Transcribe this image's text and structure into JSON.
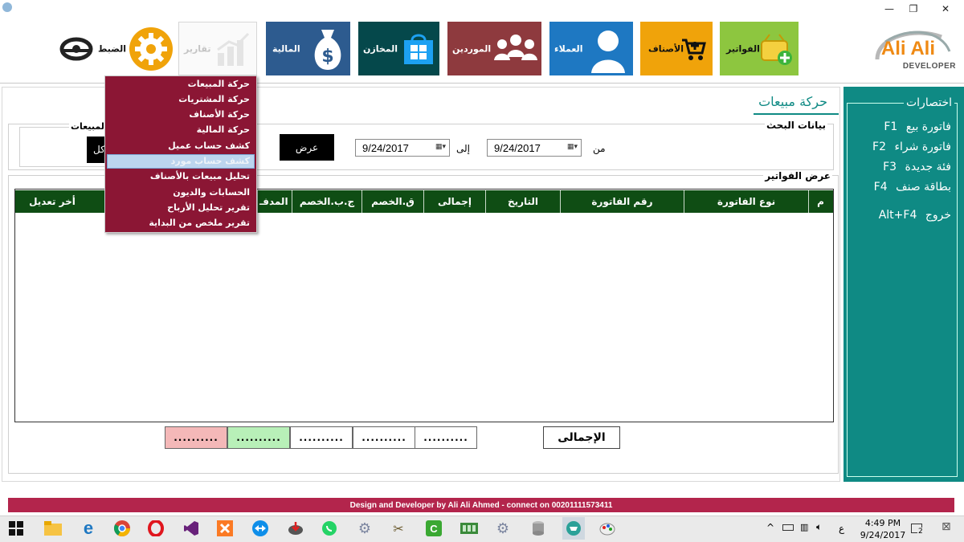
{
  "window": {
    "minimize_glyph": "—",
    "restore_glyph": "❐",
    "close_glyph": "✕"
  },
  "logo": {
    "name": "Ali Ali",
    "sub": "DEVELOPER"
  },
  "tiles": {
    "invoices": "الفواتير",
    "items": "الأصناف",
    "customers": "العملاء",
    "suppliers": "الموردين",
    "stores": "المخازن",
    "finance": "المالية",
    "reports": "تقارير",
    "settings": "الضبط"
  },
  "reports_menu": [
    "حركة المبيعات",
    "حركة المشتريات",
    "حركة الأصناف",
    "حركة المالية",
    "كشف حساب عميل",
    "كشف حساب مورد",
    "تحليل مبيعات بالأصناف",
    "الحسابات والديون",
    "تقرير تحليل الأرباح",
    "تقرير ملخص من البداية"
  ],
  "page": {
    "title": "حركة مبيعات",
    "search_section": "بيانات البحث",
    "sales_group_partial": "المبيعات",
    "all_button_partial": "كل",
    "from_label": "من",
    "to_label": "إلى",
    "from_date": "9/24/2017",
    "to_date": "9/24/2017",
    "show_button": "عرض",
    "invoices_section": "عرض الفواتير"
  },
  "table": {
    "columns": [
      "م",
      "نوع الفاتورة",
      "رقم الفاتورة",
      "التاريخ",
      "إجمالى",
      "ق.الخصم",
      "ج.ب.الخصم",
      "المدفـ",
      "أخر تعديل"
    ]
  },
  "totals": {
    "label": "الإجمالى",
    "boxes": [
      "..........",
      "..........",
      "..........",
      "..........",
      ".........."
    ]
  },
  "shortcuts": {
    "title": "اختصارات",
    "items": [
      {
        "label": "فاتورة بيع",
        "key": "F1"
      },
      {
        "label": "فاتورة شراء",
        "key": "F2"
      },
      {
        "label": "فئة جديدة",
        "key": "F3"
      },
      {
        "label": "بطاقة صنف",
        "key": "F4"
      }
    ],
    "exit": {
      "label": "خروج",
      "key": "Alt+F4"
    }
  },
  "footer": "Design and Developer by Ali Ali Ahmed - connect on 00201111573411",
  "taskbar": {
    "time": "4:49 PM",
    "date": "9/24/2017",
    "lang": "ع",
    "notif_count": "2"
  },
  "colors": {
    "teal": "#0f8a84",
    "table_header": "#0f4d14",
    "menu": "#8b1634",
    "footer": "#b3254c",
    "invoices_tile": "#8dc63f",
    "items_tile": "#f0a30a",
    "customers_tile": "#1e78c2",
    "suppliers_tile": "#8e3a3e",
    "stores_tile": "#05484b",
    "finance_tile": "#2d5b8f"
  }
}
